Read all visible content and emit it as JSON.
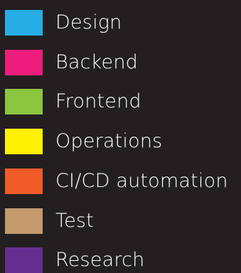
{
  "legend": {
    "items": [
      {
        "label": "Design",
        "color": "#27aee4"
      },
      {
        "label": "Backend",
        "color": "#ee1c7b"
      },
      {
        "label": "Frontend",
        "color": "#8cc540"
      },
      {
        "label": "Operations",
        "color": "#fff200"
      },
      {
        "label": "CI/CD automation",
        "color": "#f15a29"
      },
      {
        "label": "Test",
        "color": "#c49a6c"
      },
      {
        "label": "Research",
        "color": "#662d91"
      }
    ]
  }
}
